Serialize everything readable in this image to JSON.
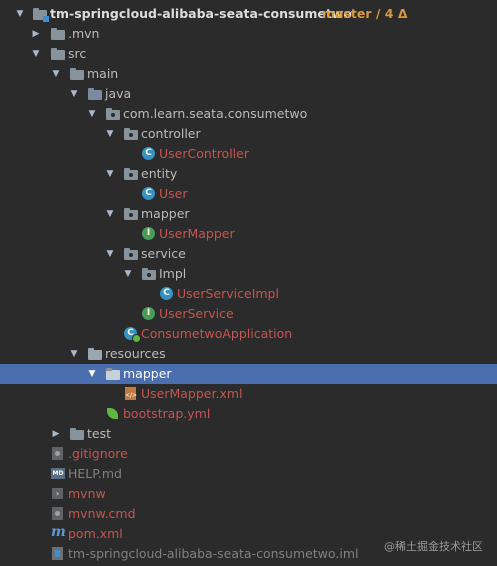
{
  "tree": {
    "root": {
      "name": "tm-springcloud-alibaba-seata-consumetwo",
      "vcs": "master / 4 Δ"
    },
    "items": [
      {
        "label": "tm-springcloud-alibaba-seata-consumetwo"
      },
      {
        "label": ".mvn"
      },
      {
        "label": "src"
      },
      {
        "label": "main"
      },
      {
        "label": "java"
      },
      {
        "label": "com.learn.seata.consumetwo"
      },
      {
        "label": "controller"
      },
      {
        "label": "UserController"
      },
      {
        "label": "entity"
      },
      {
        "label": "User"
      },
      {
        "label": "mapper"
      },
      {
        "label": "UserMapper"
      },
      {
        "label": "service"
      },
      {
        "label": "Impl"
      },
      {
        "label": "UserServiceImpl"
      },
      {
        "label": "UserService"
      },
      {
        "label": "ConsumetwoApplication"
      },
      {
        "label": "resources"
      },
      {
        "label": "mapper"
      },
      {
        "label": "UserMapper.xml"
      },
      {
        "label": "bootstrap.yml"
      },
      {
        "label": "test"
      },
      {
        "label": ".gitignore"
      },
      {
        "label": "HELP.md"
      },
      {
        "label": "mvnw"
      },
      {
        "label": "mvnw.cmd"
      },
      {
        "label": "pom.xml"
      },
      {
        "label": "tm-springcloud-alibaba-seata-consumetwo.iml"
      }
    ],
    "selected": "mapper (resources)"
  },
  "watermark": "@稀土掘金技术社区",
  "colors": {
    "background": "#2b2b2b",
    "selection": "#4b6eaf",
    "modified_file": "#c75450",
    "branch": "#d69a3c"
  }
}
